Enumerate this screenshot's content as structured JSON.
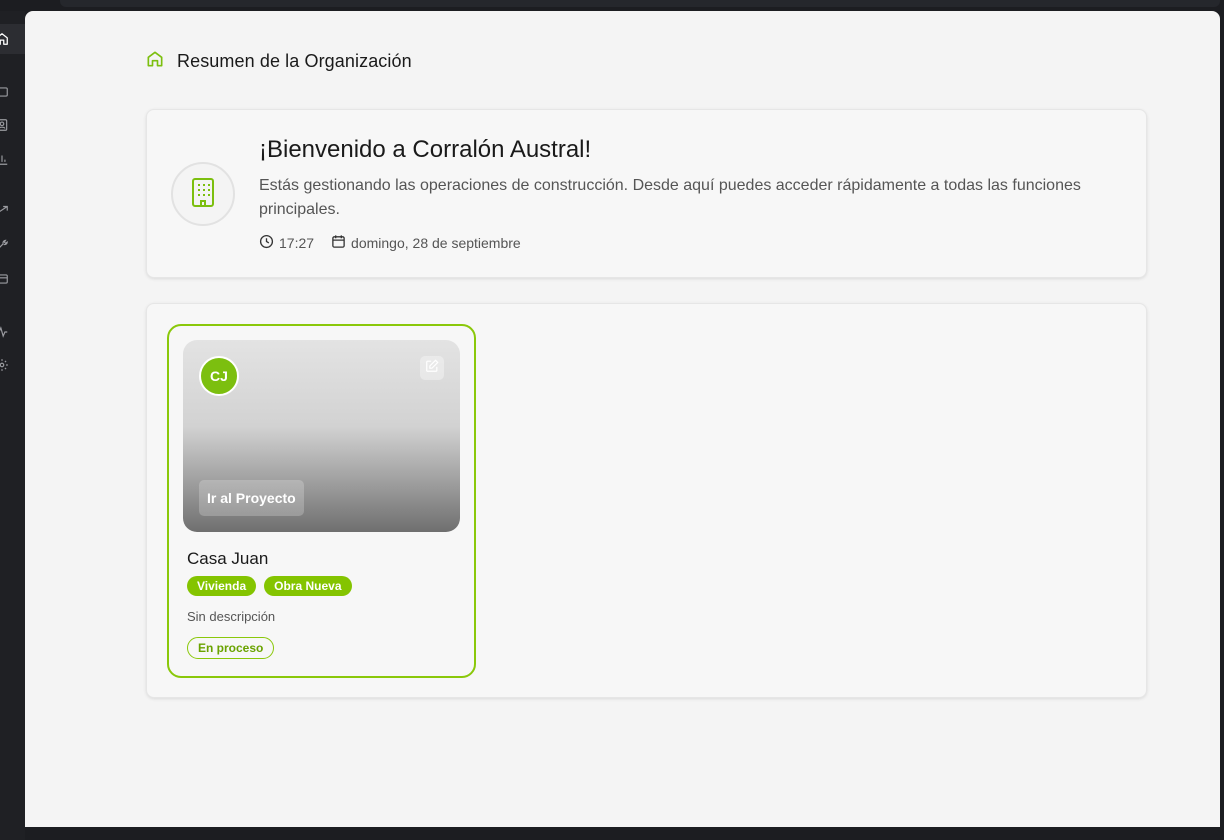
{
  "header": {
    "title": "Resumen de la Organización"
  },
  "welcome": {
    "title": "¡Bienvenido a Corralón Austral!",
    "description": "Estás gestionando las operaciones de construcción. Desde aquí puedes acceder rápidamente a todas las funciones principales.",
    "time": "17:27",
    "date": "domingo, 28 de septiembre"
  },
  "projects": [
    {
      "initials": "CJ",
      "go_label": "Ir al Proyecto",
      "name": "Casa Juan",
      "tags": [
        "Vivienda",
        "Obra Nueva"
      ],
      "description": "Sin descripción",
      "status": "En proceso"
    }
  ],
  "sidebar": {
    "items": [
      {
        "icon": "home-icon",
        "active": true
      },
      {
        "icon": "folder-icon"
      },
      {
        "icon": "contacts-icon"
      },
      {
        "icon": "bar-chart-icon"
      },
      {
        "icon": "trending-icon"
      },
      {
        "icon": "tools-icon"
      },
      {
        "icon": "wallet-icon"
      },
      {
        "icon": "activity-icon"
      },
      {
        "icon": "settings-icon"
      }
    ]
  },
  "colors": {
    "accent": "#84c400",
    "background": "#f4f4f4",
    "sidebar": "#1f2024"
  }
}
